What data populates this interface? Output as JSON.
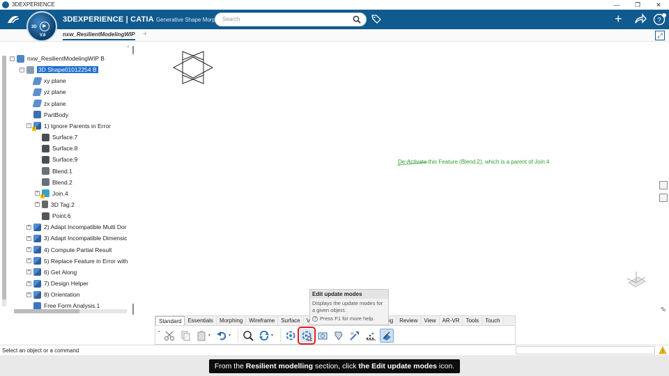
{
  "window": {
    "title": "3DEXPERIENCE",
    "buttons": [
      "—",
      "❐",
      "✕"
    ]
  },
  "header": {
    "compass": {
      "label_3d": "3D",
      "version": "V.6"
    },
    "brand_bold": "3DEXPERIENCE | CATIA",
    "brand_app": "Generative Shape Morphing",
    "search_placeholder": "Search",
    "plus": "+"
  },
  "doc_tab": {
    "label": "nxw_ResilientModelingWIP",
    "new_tab": "+"
  },
  "tree": {
    "collapse": "‹",
    "nodes": [
      {
        "id": "root",
        "label": "nxw_ResilientModelingWIP B",
        "icon": "product-icon",
        "exp": "−",
        "selected": false
      },
      {
        "id": "shape",
        "label": "3D Shape01012254 B",
        "icon": "3dshape-icon",
        "exp": "−",
        "selected": true
      },
      {
        "id": "xy",
        "label": "xy plane",
        "icon": "plane-icon"
      },
      {
        "id": "yz",
        "label": "yz plane",
        "icon": "plane-icon"
      },
      {
        "id": "zx",
        "label": "zx plane",
        "icon": "plane-icon"
      },
      {
        "id": "partbody",
        "label": "PartBody",
        "icon": "body-icon"
      },
      {
        "id": "gs1",
        "label": "1) Ignore Parents in Error",
        "icon": "geoset-icon",
        "exp": "−",
        "warn": true
      },
      {
        "id": "s7",
        "label": "Surface.7",
        "icon": "surface-icon"
      },
      {
        "id": "s8",
        "label": "Surface.8",
        "icon": "surface-icon"
      },
      {
        "id": "s9",
        "label": "Surface.9",
        "icon": "surface-icon"
      },
      {
        "id": "b1",
        "label": "Blend.1",
        "icon": "blend-icon"
      },
      {
        "id": "b2",
        "label": "Blend.2",
        "icon": "blend-icon"
      },
      {
        "id": "j4",
        "label": "Join.4",
        "icon": "join-icon",
        "exp": "+",
        "warn": true
      },
      {
        "id": "t2",
        "label": "3D Tag.2",
        "icon": "tag-icon",
        "exp": "+"
      },
      {
        "id": "p6",
        "label": "Point.6",
        "icon": "point-icon"
      },
      {
        "id": "gs2",
        "label": "2) Adapt Incompatible Multi Dor",
        "icon": "geoset-icon",
        "exp": "+"
      },
      {
        "id": "gs3",
        "label": "3) Adapt Incompatible Dimensic",
        "icon": "geoset-icon",
        "exp": "+"
      },
      {
        "id": "gs4",
        "label": "4) Compute Partial Result",
        "icon": "geoset-icon",
        "exp": "+"
      },
      {
        "id": "gs5",
        "label": "5) Replace Feature in Error with",
        "icon": "geoset-icon",
        "exp": "+"
      },
      {
        "id": "gs6",
        "label": "6) Get Along",
        "icon": "geoset-icon",
        "exp": "+"
      },
      {
        "id": "gs7",
        "label": "7) Design Helper",
        "icon": "geoset-icon",
        "exp": "+"
      },
      {
        "id": "gs8",
        "label": "8) Orientation",
        "icon": "geoset-icon",
        "exp": "+"
      },
      {
        "id": "ffa",
        "label": "Free Form Analysis.1",
        "icon": "analysis-icon"
      }
    ]
  },
  "viewport": {
    "annotation": "De-Activate this Feature (Blend.2), which is a parent of Join.4",
    "annotation_color": "#2f9e2f"
  },
  "tooltip": {
    "title": "Edit update modes",
    "body": "Displays the update modes for a given object.",
    "help": "Press F1 for more help."
  },
  "action_bar": {
    "tabs": [
      "Standard",
      "Essentials",
      "Morphing",
      "Wireframe",
      "Surface",
      "Volu",
      "",
      "ent Modeling",
      "Review",
      "View",
      "AR-VR",
      "Tools",
      "Touch"
    ],
    "active_tab": "Standard",
    "icons": [
      "cut-icon",
      "copy-icon",
      "paste-icon",
      "undo-icon",
      "zoom-icon",
      "update-icon",
      "update-settings-icon",
      "edit-update-modes-icon",
      "snapshot-icon",
      "pin-tool-icon",
      "replace-icon",
      "points-icon",
      "resilient-icon"
    ]
  },
  "status": {
    "text": "Select an object or a command"
  },
  "caption": {
    "part1": "From the ",
    "bold1": "Resilient modelling",
    "part2": " section, click ",
    "bold2": "the Edit update modes",
    "part3": " icon."
  },
  "colors": {
    "header_blue": "#0f5a8f",
    "selection_blue": "#1f6fd1",
    "highlight_red": "#e01b1b"
  }
}
